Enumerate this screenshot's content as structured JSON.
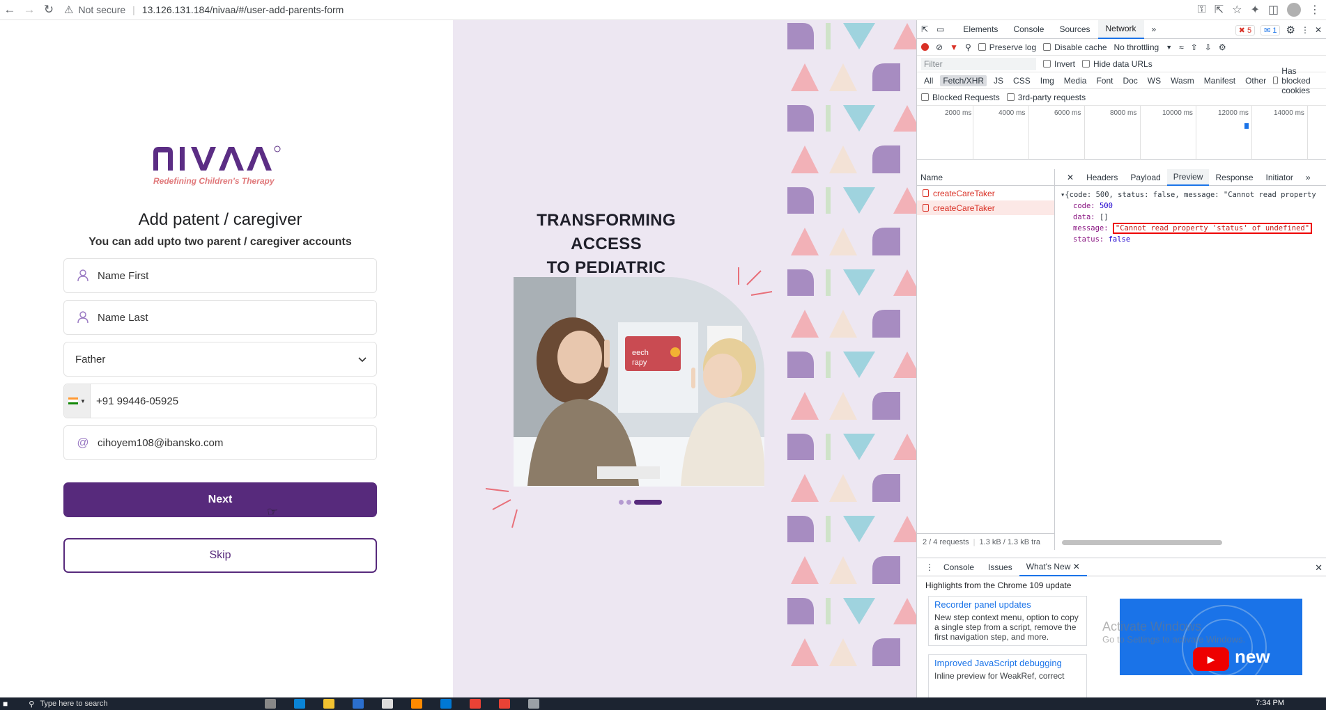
{
  "browser": {
    "security_label": "Not secure",
    "url": "13.126.131.184/nivaa/#/user-add-parents-form"
  },
  "brand": {
    "name": "NIVAA",
    "tagline": "Redefining Children's Therapy",
    "primary_color": "#572a7c",
    "accent_color": "#e0787a"
  },
  "form": {
    "title": "Add patent / caregiver",
    "subtitle": "You can add upto two parent / caregiver accounts",
    "first_name_placeholder": "Name First",
    "last_name_placeholder": "Name Last",
    "relation_value": "Father",
    "phone_value": "+91 99446-05925",
    "email_value": "cihoyem108@ibansko.com",
    "next_label": "Next",
    "skip_label": "Skip"
  },
  "promo": {
    "title_line1": "TRANSFORMING ACCESS",
    "title_line2": "TO PEDIATRIC THERAPY",
    "carousel_active_index": 2,
    "carousel_count": 3
  },
  "devtools": {
    "tabs": [
      "Elements",
      "Console",
      "Sources",
      "Network"
    ],
    "active_tab": "Network",
    "error_count": "5",
    "message_count": "1",
    "toolbar": {
      "preserve_log": "Preserve log",
      "disable_cache": "Disable cache",
      "throttling": "No throttling"
    },
    "filter_placeholder": "Filter",
    "filter_options": [
      "Invert",
      "Hide data URLs"
    ],
    "types": [
      "All",
      "Fetch/XHR",
      "JS",
      "CSS",
      "Img",
      "Media",
      "Font",
      "Doc",
      "WS",
      "Wasm",
      "Manifest",
      "Other"
    ],
    "blocked_cookies": "Has blocked cookies",
    "blocked_requests": "Blocked Requests",
    "third_party": "3rd-party requests",
    "timeline_ticks": [
      "2000 ms",
      "4000 ms",
      "6000 ms",
      "8000 ms",
      "10000 ms",
      "12000 ms",
      "14000 ms"
    ],
    "name_column": "Name",
    "requests": [
      "createCareTaker",
      "createCareTaker"
    ],
    "footer": "2 / 4 requests",
    "footer_size": "1.3 kB / 1.3 kB tra",
    "detail_tabs": [
      "Headers",
      "Payload",
      "Preview",
      "Response",
      "Initiator"
    ],
    "active_detail_tab": "Preview",
    "preview": {
      "summary": "{code: 500, status: false, message: \"Cannot read property",
      "code_key": "code:",
      "code_val": "500",
      "data_key": "data:",
      "data_val": "[]",
      "message_key": "message:",
      "message_val": "\"Cannot read property 'status' of undefined\"",
      "status_key": "status:",
      "status_val": "false"
    },
    "drawer_tabs": [
      "Console",
      "Issues",
      "What's New"
    ],
    "active_drawer_tab": "What's New",
    "highlights": "Highlights from the Chrome 109 update",
    "card1_title": "Recorder panel updates",
    "card1_body": "New step context menu, option to copy a single step from a script, remove the first navigation step, and more.",
    "card2_title": "Improved JavaScript debugging",
    "card2_body": "Inline preview for WeakRef, correct",
    "video_text": "new",
    "watermark_line1": "Activate Windows",
    "watermark_line2": "Go to Settings to activate Windows."
  },
  "taskbar": {
    "search_placeholder": "Type here to search",
    "clock": "7:34 PM"
  }
}
